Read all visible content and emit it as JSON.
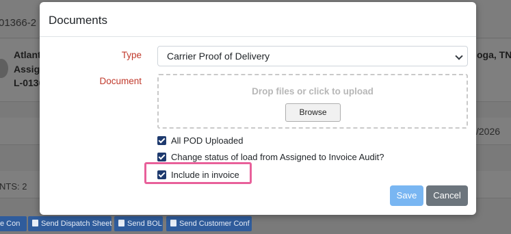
{
  "background": {
    "load_id": "01366-2",
    "carrier_line1": "Atlant",
    "carrier_line2": "Assig",
    "carrier_line3": "L-0136",
    "destination": "oga, TN",
    "date": "/2026",
    "counts": "NTS: 2",
    "buttons": [
      {
        "label": "e Con",
        "icon": "file-icon"
      },
      {
        "label": "Send Dispatch Sheet",
        "icon": "truck-icon"
      },
      {
        "label": "Send BOL",
        "icon": "file-icon"
      },
      {
        "label": "Send Customer Conf",
        "icon": "user-gear-icon"
      }
    ]
  },
  "modal": {
    "title": "Documents",
    "type_label": "Type",
    "type_value": "Carrier Proof of Delivery",
    "document_label": "Document",
    "dropzone_text": "Drop files or click to upload",
    "browse_label": "Browse",
    "checkboxes": [
      {
        "label": "All POD Uploaded",
        "checked": true
      },
      {
        "label": "Change status of load from Assigned to Invoice Audit?",
        "checked": true
      },
      {
        "label": "Include in invoice",
        "checked": true
      }
    ],
    "save_label": "Save",
    "cancel_label": "Cancel"
  },
  "colors": {
    "label_red": "#c0392b",
    "checkbox": "#1e3a6e",
    "highlight": "#e8609a",
    "save": "#79b6f2",
    "cancel": "#6c757d"
  }
}
